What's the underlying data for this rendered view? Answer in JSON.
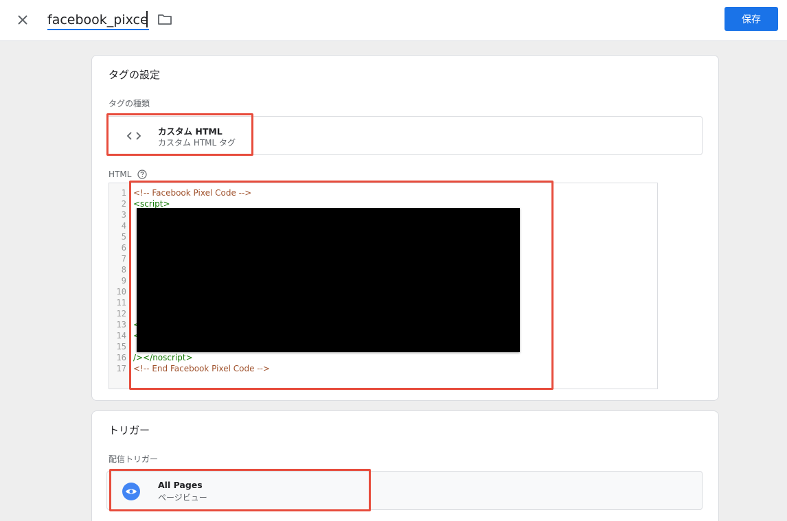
{
  "header": {
    "tag_name": "facebook_pixcel",
    "save_label": "保存"
  },
  "tag_config": {
    "title": "タグの設定",
    "type_label": "タグの種類",
    "type": {
      "title": "カスタム HTML",
      "subtitle": "カスタム HTML タグ",
      "icon": "code-brackets-icon"
    },
    "html_label": "HTML",
    "code_lines": [
      {
        "n": "1",
        "text": "<!-- Facebook Pixel Code -->",
        "kind": "comment"
      },
      {
        "n": "2",
        "text": "<script>",
        "kind": "tag"
      },
      {
        "n": "3",
        "text": "",
        "kind": "tag"
      },
      {
        "n": "4",
        "text": "",
        "kind": "tag"
      },
      {
        "n": "5",
        "text": "",
        "kind": "tag"
      },
      {
        "n": "6",
        "text": "",
        "kind": "tag"
      },
      {
        "n": "7",
        "text": "",
        "kind": "tag"
      },
      {
        "n": "8",
        "text": "",
        "kind": "tag"
      },
      {
        "n": "9",
        "text": "",
        "kind": "tag"
      },
      {
        "n": "10",
        "text": "",
        "kind": "tag"
      },
      {
        "n": "11",
        "text": "",
        "kind": "tag"
      },
      {
        "n": "12",
        "text": "",
        "kind": "tag"
      },
      {
        "n": "13",
        "text": "<",
        "kind": "tag"
      },
      {
        "n": "14",
        "text": "<",
        "kind": "tag"
      },
      {
        "n": "15",
        "text": "",
        "kind": "tag"
      },
      {
        "n": "16",
        "text": "/></noscript>",
        "kind": "tag"
      },
      {
        "n": "17",
        "text": "<!-- End Facebook Pixel Code -->",
        "kind": "comment"
      }
    ]
  },
  "trigger": {
    "title": "トリガー",
    "label": "配信トリガー",
    "item": {
      "title": "All Pages",
      "subtitle": "ページビュー",
      "icon": "eye-icon"
    }
  },
  "colors": {
    "accent": "#1a73e8",
    "highlight": "#e74c3c",
    "comment": "#a0522d",
    "tag": "#117700"
  }
}
